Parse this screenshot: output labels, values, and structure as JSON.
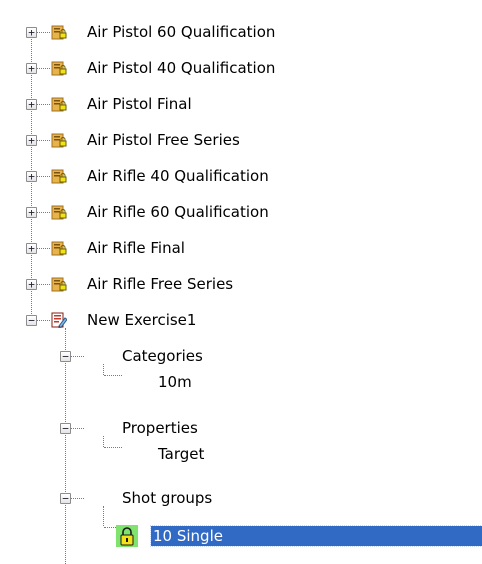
{
  "tree": {
    "exercises": [
      {
        "label": "Air Pistol 60 Qualification",
        "icon": "locked-exercise-icon",
        "expanded": false
      },
      {
        "label": "Air Pistol 40 Qualification",
        "icon": "locked-exercise-icon",
        "expanded": false
      },
      {
        "label": "Air Pistol Final",
        "icon": "locked-exercise-icon",
        "expanded": false
      },
      {
        "label": "Air Pistol Free Series",
        "icon": "locked-exercise-icon",
        "expanded": false
      },
      {
        "label": "Air Rifle 40 Qualification",
        "icon": "locked-exercise-icon",
        "expanded": false
      },
      {
        "label": "Air Rifle 60 Qualification",
        "icon": "locked-exercise-icon",
        "expanded": false
      },
      {
        "label": "Air Rifle Final",
        "icon": "locked-exercise-icon",
        "expanded": false
      },
      {
        "label": "Air Rifle Free Series",
        "icon": "locked-exercise-icon",
        "expanded": false
      },
      {
        "label": "New Exercise1",
        "icon": "edit-exercise-icon",
        "expanded": true
      }
    ],
    "new_exercise": {
      "groups": [
        {
          "label": "Categories",
          "expanded": true,
          "children": [
            {
              "label": "10m",
              "selected": false
            }
          ]
        },
        {
          "label": "Properties",
          "expanded": true,
          "children": [
            {
              "label": "Target",
              "selected": false
            }
          ]
        },
        {
          "label": "Shot groups",
          "expanded": true,
          "children": [
            {
              "label": "10 Single",
              "icon": "padlock-icon",
              "selected": true
            }
          ]
        }
      ]
    },
    "expander_symbols": {
      "collapsed": "+",
      "expanded": "−"
    }
  },
  "colors": {
    "selection_background": "#316ac5",
    "selection_text": "#ffffff",
    "folder_gold": "#e8b44a",
    "padlock_yellow": "#f3e21a",
    "padlock_halo": "#7fe36e",
    "edit_red": "#c0392b"
  }
}
